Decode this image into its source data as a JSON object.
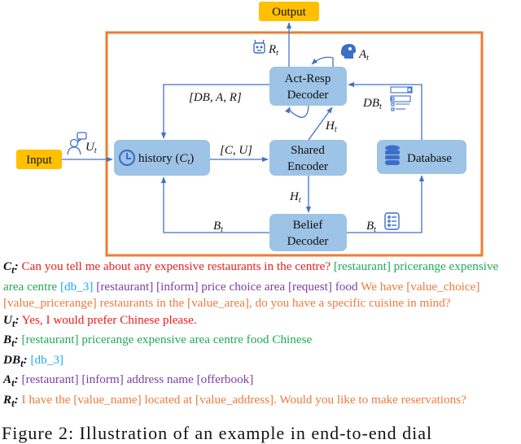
{
  "diagram": {
    "nodes": {
      "output": "Output",
      "input": "Input",
      "act_resp_decoder": [
        "Act-Resp",
        "Decoder"
      ],
      "history": "history",
      "history_var": "C",
      "shared_encoder": [
        "Shared",
        "Encoder"
      ],
      "database": "Database",
      "belief_decoder": [
        "Belief",
        "Decoder"
      ]
    },
    "edge_labels": {
      "response": "R",
      "action": "A",
      "user_utterance": "U",
      "history_update": "[DB, A, R]",
      "encoder_input": "[C, U]",
      "hidden_to_act": "H",
      "hidden_to_belief": "H",
      "db_result": "DB",
      "belief_to_history": "B",
      "belief_to_db": "B",
      "subscript": "t"
    },
    "icons": [
      "robot-icon",
      "head-brain-icon",
      "user-chat-icon",
      "clock-icon",
      "database-icon",
      "search-form-icon",
      "list-icon"
    ],
    "colors": {
      "frame": "#ed7d31",
      "box_fill": "#9dc3e6",
      "arrow": "#4472c4",
      "io_fill": "#ffc000",
      "icon": "#3d6fc7"
    }
  },
  "legend": {
    "c": {
      "key": "C",
      "segments": [
        {
          "color": "red",
          "text": "Can you tell me about any expensive restaurants in the centre? "
        },
        {
          "color": "green",
          "text": "[restaurant] pricerange expensive area centre "
        },
        {
          "color": "blue",
          "text": "[db_3]  "
        },
        {
          "color": "purple",
          "text": "[restaurant] [inform] price choice area [request] food "
        },
        {
          "color": "orange",
          "text": "We have [value_choice] [value_pricerange] restaurants in the [value_area], do you have a specific cuisine in mind?"
        }
      ]
    },
    "u": {
      "key": "U",
      "text": "Yes, I would prefer Chinese please."
    },
    "b": {
      "key": "B",
      "text": "[restaurant] pricerange expensive area centre food Chinese"
    },
    "db": {
      "key": "DB",
      "text": "[db_3]"
    },
    "a": {
      "key": "A",
      "text": "[restaurant] [inform] address name [offerbook]"
    },
    "r": {
      "key": "R",
      "text": "I have the [value_name] located at [value_address]. Would you like to make reservations?"
    }
  },
  "caption": "Figure 2:  Illustration of an example in end-to-end dial"
}
